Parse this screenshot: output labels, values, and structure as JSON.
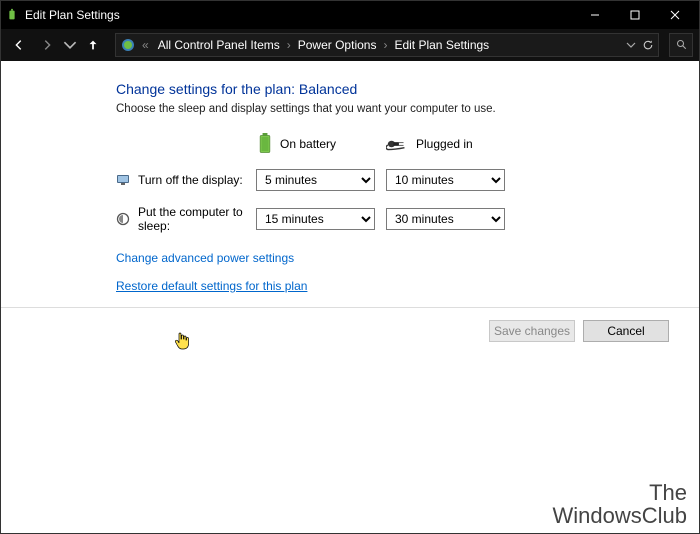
{
  "window": {
    "title": "Edit Plan Settings"
  },
  "breadcrumb": {
    "item0": "All Control Panel Items",
    "item1": "Power Options",
    "item2": "Edit Plan Settings"
  },
  "page": {
    "heading": "Change settings for the plan: Balanced",
    "subheading": "Choose the sleep and display settings that you want your computer to use."
  },
  "columns": {
    "battery": "On battery",
    "plugged": "Plugged in"
  },
  "rows": {
    "display_label": "Turn off the display:",
    "sleep_label": "Put the computer to sleep:"
  },
  "values": {
    "display_battery": "5 minutes",
    "display_plugged": "10 minutes",
    "sleep_battery": "15 minutes",
    "sleep_plugged": "30 minutes"
  },
  "links": {
    "advanced": "Change advanced power settings",
    "restore": "Restore default settings for this plan"
  },
  "buttons": {
    "save": "Save changes",
    "cancel": "Cancel"
  },
  "watermark": {
    "line1": "The",
    "line2": "WindowsClub"
  }
}
